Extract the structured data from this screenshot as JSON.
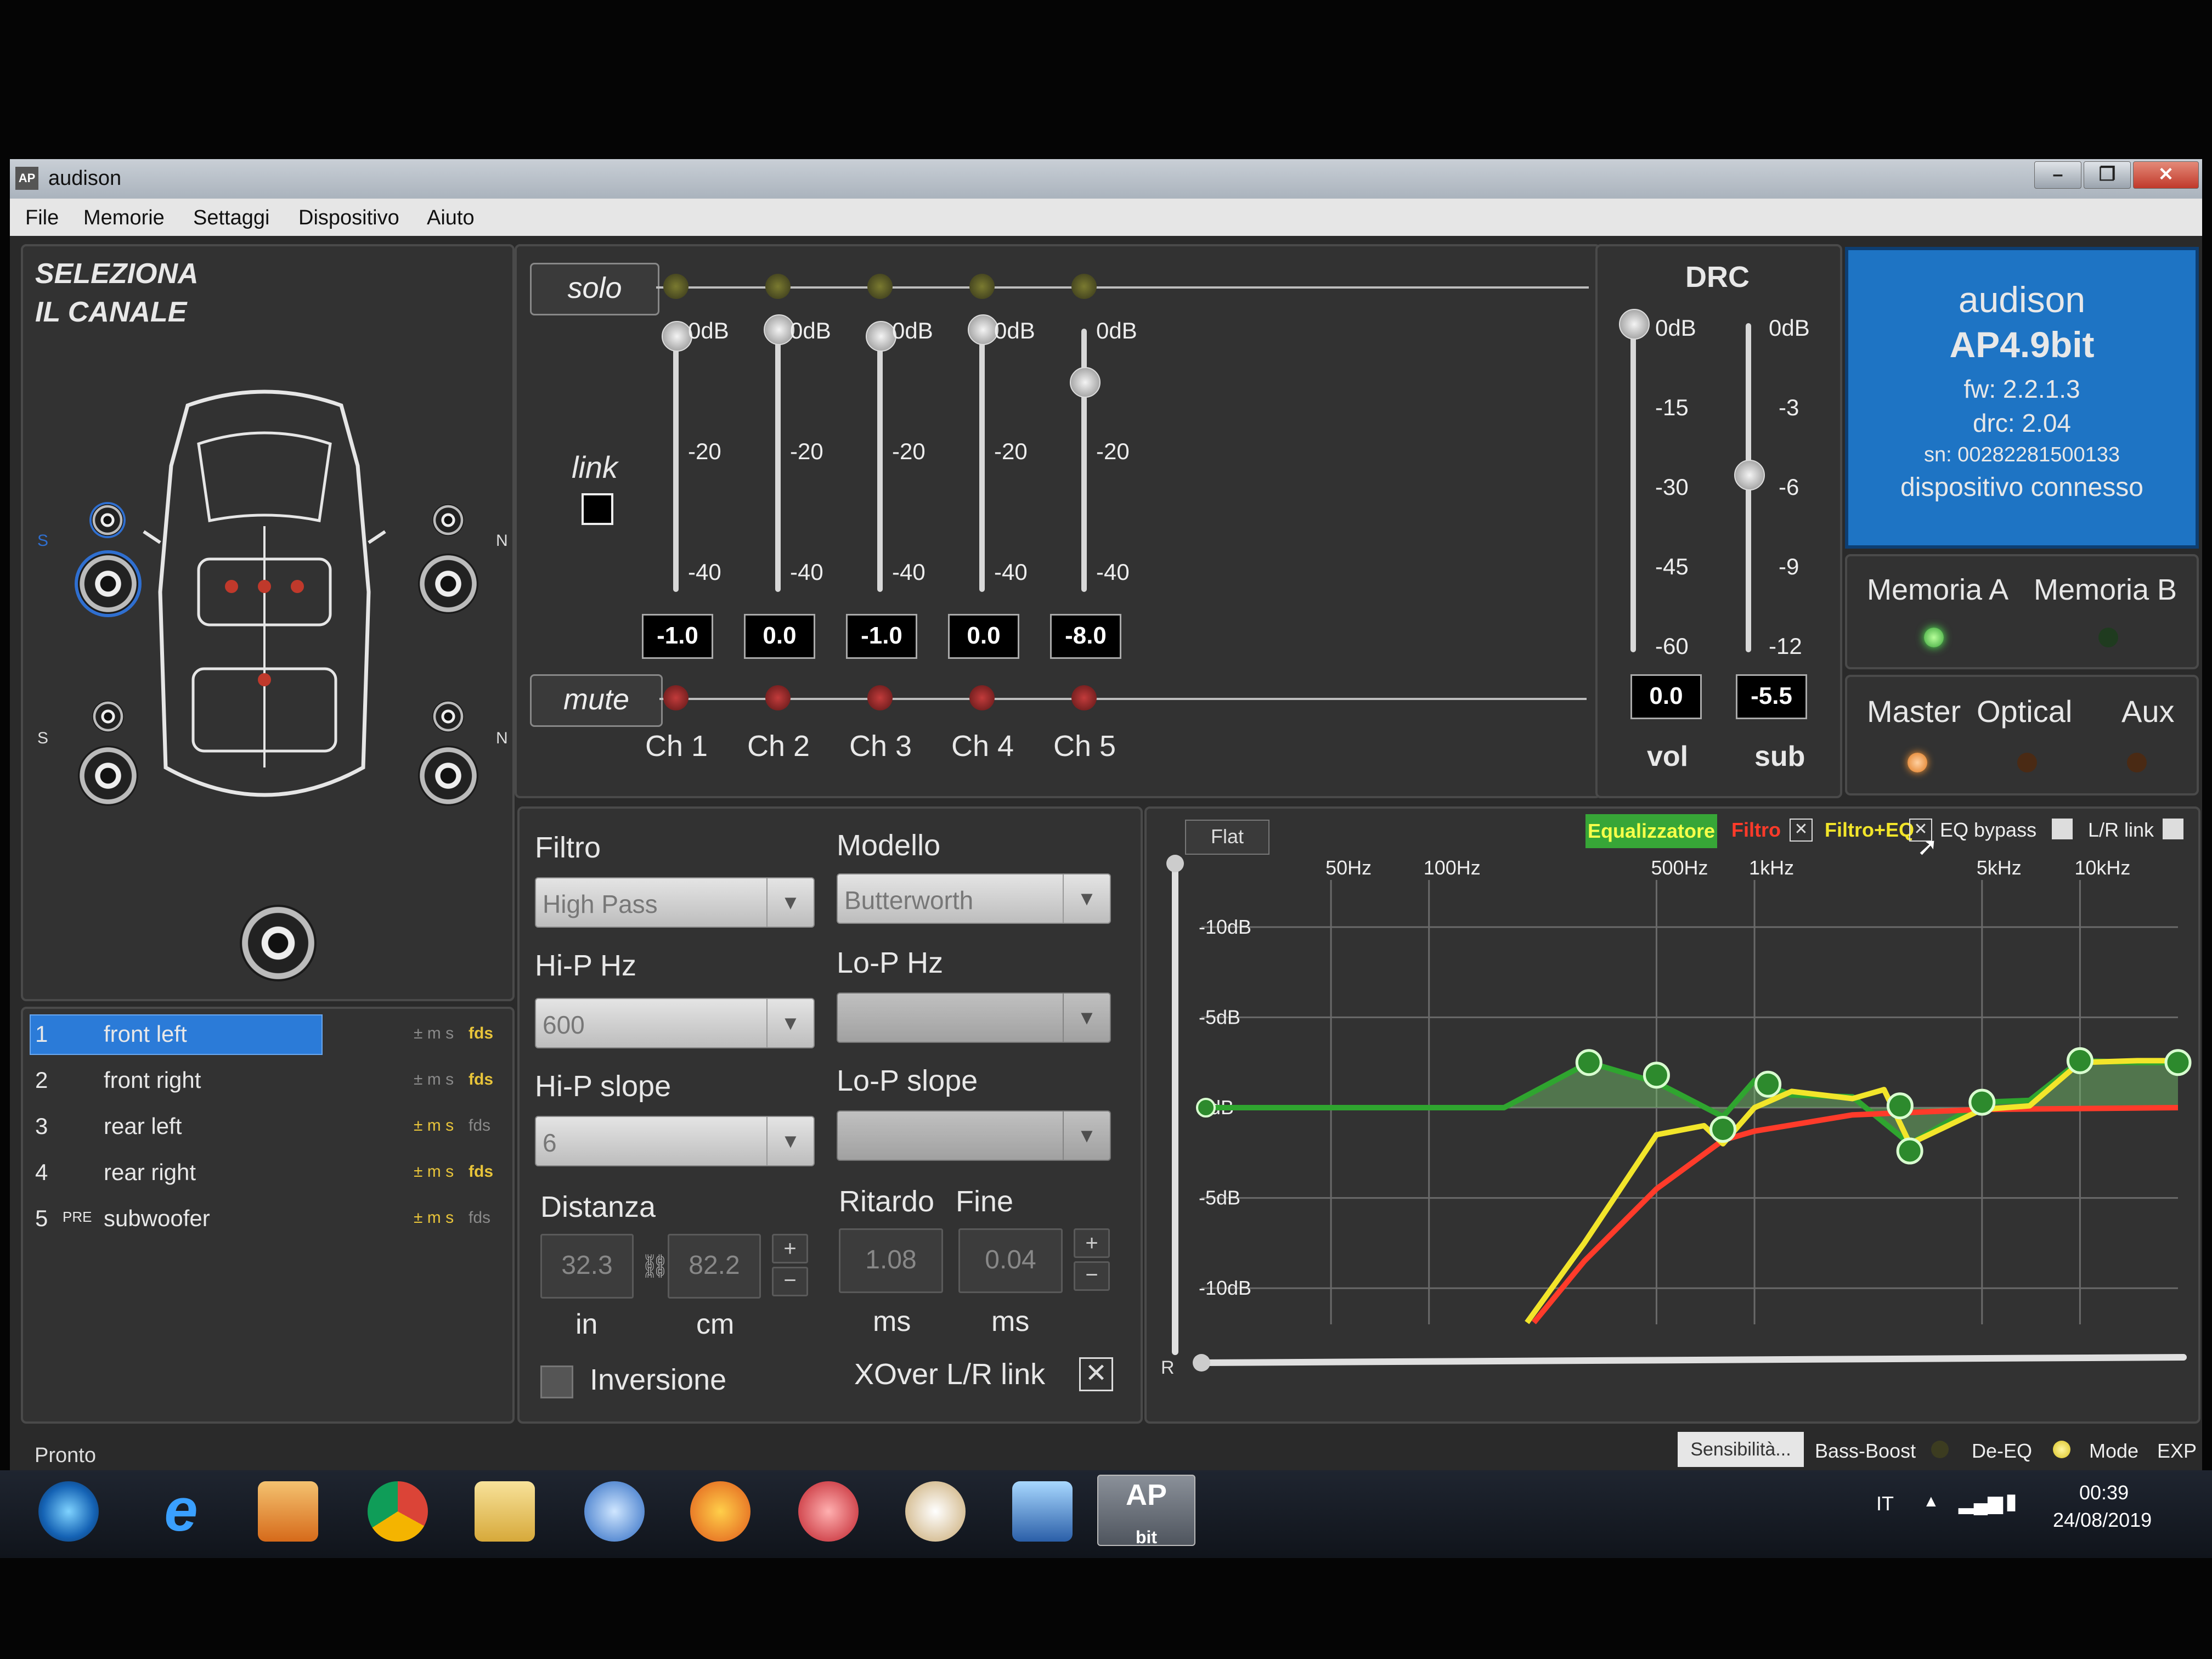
{
  "window": {
    "title": "audison",
    "app_icon": "AP",
    "controls": [
      "–",
      "❐",
      "✕"
    ]
  },
  "menu": [
    "File",
    "Memorie",
    "Settaggi",
    "Dispositivo",
    "Aiuto"
  ],
  "channel_select": {
    "title_line1": "SELEZIONA",
    "title_line2": "IL CANALE",
    "left_marker": "S",
    "right_marker": "N",
    "channels": [
      {
        "num": "1",
        "prefix": "",
        "name": "front left",
        "flags": "± m s",
        "fds": "fds",
        "selected": true
      },
      {
        "num": "2",
        "prefix": "",
        "name": "front right",
        "flags": "± m s",
        "fds": "fds",
        "selected": false
      },
      {
        "num": "3",
        "prefix": "",
        "name": "rear left",
        "flags": "± m s",
        "fds": "fds",
        "selected": false
      },
      {
        "num": "4",
        "prefix": "",
        "name": "rear right",
        "flags": "± m s",
        "fds": "fds",
        "selected": false
      },
      {
        "num": "5",
        "prefix": "PRE",
        "name": "subwoofer",
        "flags": "± m s",
        "fds": "fds",
        "selected": false
      }
    ]
  },
  "mixer": {
    "solo_label": "solo",
    "mute_label": "mute",
    "link_label": "link",
    "scale": [
      "0dB",
      "-20",
      "-40"
    ],
    "channels": [
      {
        "name": "Ch 1",
        "value": "-1.0",
        "level_db": -1.0
      },
      {
        "name": "Ch 2",
        "value": "0.0",
        "level_db": 0.0
      },
      {
        "name": "Ch 3",
        "value": "-1.0",
        "level_db": -1.0
      },
      {
        "name": "Ch 4",
        "value": "0.0",
        "level_db": 0.0
      },
      {
        "name": "Ch 5",
        "value": "-8.0",
        "level_db": -8.0
      }
    ]
  },
  "drc": {
    "title": "DRC",
    "vol_scale": [
      "0dB",
      "-15",
      "-30",
      "-45",
      "-60"
    ],
    "sub_scale": [
      "0dB",
      "-3",
      "-6",
      "-9",
      "-12"
    ],
    "vol_value": "0.0",
    "sub_value": "-5.5",
    "vol_label": "vol",
    "sub_label": "sub"
  },
  "device": {
    "brand": "audison",
    "model": "AP4.9bit",
    "fw": "fw: 2.2.1.3",
    "drc": "drc: 2.04",
    "sn": "sn: 00282281500133",
    "status": "dispositivo connesso"
  },
  "memory": {
    "a_label": "Memoria A",
    "b_label": "Memoria B",
    "active": "A"
  },
  "inputs": {
    "master": "Master",
    "optical": "Optical",
    "aux": "Aux",
    "active": "Master"
  },
  "filter": {
    "filtro_label": "Filtro",
    "filtro_value": "High Pass",
    "modello_label": "Modello",
    "modello_value": "Butterworth",
    "hip_hz_label": "Hi-P Hz",
    "hip_hz_value": "600",
    "lop_hz_label": "Lo-P Hz",
    "lop_hz_value": "",
    "hip_slope_label": "Hi-P slope",
    "hip_slope_value": "6",
    "lop_slope_label": "Lo-P slope",
    "lop_slope_value": "",
    "distanza_label": "Distanza",
    "dist_in": "32.3",
    "dist_cm": "82.2",
    "unit_in": "in",
    "unit_cm": "cm",
    "ritardo_label": "Ritardo",
    "fine_label": "Fine",
    "ritardo_value": "1.08",
    "fine_value": "0.04",
    "unit_ms": "ms",
    "inversione_label": "Inversione",
    "xover_label": "XOver L/R link"
  },
  "eq": {
    "flat_label": "Flat",
    "equalizzatore": "Equalizzatore",
    "filtro": "Filtro",
    "filtro_eq": "Filtro+EQ",
    "eq_bypass": "EQ bypass",
    "lr_link": "L/R link",
    "r_label": "R",
    "colors": {
      "eq": "#2fa52f",
      "filtro": "#ff3b2a",
      "filtro_eq": "#f2e52a"
    }
  },
  "chart_data": {
    "type": "line",
    "x_scale": "log",
    "xlim": [
      20,
      20000
    ],
    "ylim": [
      -12,
      12
    ],
    "x_ticks": [
      {
        "v": 50,
        "label": "50Hz"
      },
      {
        "v": 100,
        "label": "100Hz"
      },
      {
        "v": 500,
        "label": "500Hz"
      },
      {
        "v": 1000,
        "label": "1kHz"
      },
      {
        "v": 5000,
        "label": "5kHz"
      },
      {
        "v": 10000,
        "label": "10kHz"
      }
    ],
    "y_ticks": [
      {
        "v": 10,
        "label": "-10dB"
      },
      {
        "v": 5,
        "label": "-5dB"
      },
      {
        "v": 0,
        "label": "0dB"
      },
      {
        "v": -5,
        "label": "-5dB"
      },
      {
        "v": -10,
        "label": "-10dB"
      }
    ],
    "grid": true,
    "series": [
      {
        "key": "eq",
        "x": [
          20,
          170,
          310,
          500,
          800,
          1000,
          1300,
          2000,
          3000,
          5000,
          7000,
          10000,
          15000,
          20000
        ],
        "y": [
          0,
          0,
          2.5,
          1.4,
          -0.5,
          1.5,
          0.7,
          0.6,
          -2.0,
          0.3,
          0.4,
          2.6,
          2.5,
          2.5
        ]
      },
      {
        "key": "filtro",
        "x": [
          210,
          300,
          500,
          800,
          1000,
          2000,
          5000,
          20000
        ],
        "y": [
          -11.9,
          -8.5,
          -4.5,
          -1.8,
          -1.3,
          -0.4,
          -0.1,
          0
        ]
      },
      {
        "key": "filtro_eq",
        "x": [
          200,
          300,
          500,
          700,
          800,
          1000,
          1300,
          2000,
          2500,
          3000,
          5000,
          7000,
          10000,
          15000,
          20000
        ],
        "y": [
          -11.9,
          -7.5,
          -1.5,
          -1.0,
          -2.0,
          0,
          0.9,
          0.5,
          1.0,
          -2.0,
          -0.1,
          0.1,
          2.5,
          2.6,
          2.6
        ]
      }
    ],
    "nodes": [
      {
        "x": 310,
        "y": 2.5
      },
      {
        "x": 500,
        "y": 1.8
      },
      {
        "x": 800,
        "y": -1.2
      },
      {
        "x": 1100,
        "y": 1.3
      },
      {
        "x": 2800,
        "y": 0.1
      },
      {
        "x": 3000,
        "y": -2.4
      },
      {
        "x": 5000,
        "y": 0.3
      },
      {
        "x": 10000,
        "y": 2.6
      },
      {
        "x": 20000,
        "y": 2.5
      }
    ]
  },
  "statusbar": {
    "text": "Pronto",
    "sensibilita": "Sensibilità...",
    "bass_boost": "Bass-Boost",
    "de_eq": "De-EQ",
    "mode": "Mode",
    "exp": "EXP"
  },
  "taskbar": {
    "lang": "IT",
    "time": "00:39",
    "date": "24/08/2019",
    "apps": [
      "start-orb",
      "internet-explorer",
      "media-player",
      "chrome",
      "file-explorer",
      "thunderbird",
      "firefox",
      "app-red",
      "paint",
      "remote-desktop",
      "audison-ap-bit"
    ]
  }
}
